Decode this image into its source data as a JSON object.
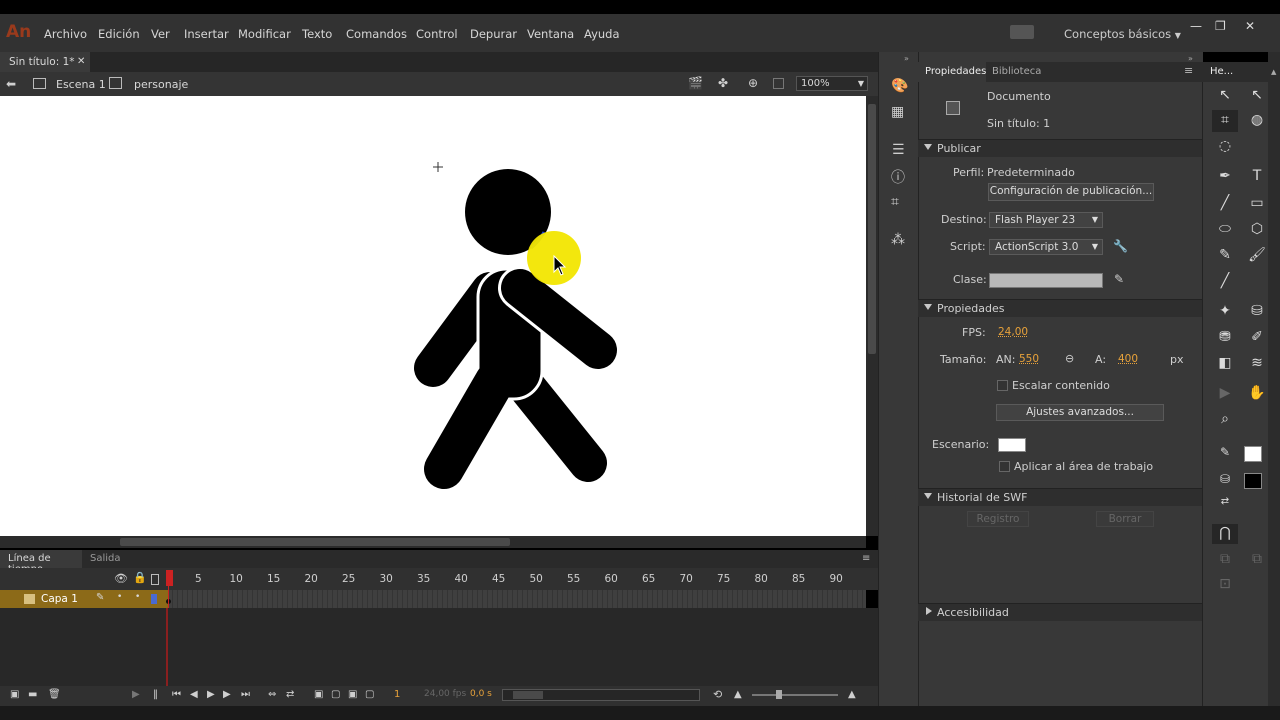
{
  "app": {
    "logo": "An",
    "menu": [
      "Archivo",
      "Edición",
      "Ver",
      "Insertar",
      "Modificar",
      "Texto",
      "Comandos",
      "Control",
      "Depurar",
      "Ventana",
      "Ayuda"
    ],
    "workspace": "Conceptos básicos",
    "window_buttons": [
      "—",
      "❐",
      "✕"
    ]
  },
  "document": {
    "tab_title": "Sin título: 1*",
    "breadcrumb_scene": "Escena 1",
    "breadcrumb_symbol": "personaje",
    "zoom": "100%"
  },
  "timeline": {
    "tabs": [
      "Línea de tiempo",
      "Salida"
    ],
    "layer_name": "Capa 1",
    "frame_ticks": [
      "1",
      "5",
      "10",
      "15",
      "20",
      "25",
      "30",
      "35",
      "40",
      "45",
      "50",
      "55",
      "60",
      "65",
      "70",
      "75",
      "80",
      "85",
      "90"
    ],
    "current_frame": "1",
    "fps_readout": "24,00 fps",
    "time_readout": "0,0 s"
  },
  "properties": {
    "tabs": [
      "Propiedades",
      "Biblioteca"
    ],
    "doc_type": "Documento",
    "doc_name": "Sin título: 1",
    "publish_section": "Publicar",
    "profile_label": "Perfil:",
    "profile_value": "Predeterminado",
    "publish_settings_button": "Configuración de publicación...",
    "target_label": "Destino:",
    "target_value": "Flash Player 23",
    "script_label": "Script:",
    "script_value": "ActionScript 3.0",
    "class_label": "Clase:",
    "props_section": "Propiedades",
    "fps_label": "FPS:",
    "fps_value": "24,00",
    "size_label": "Tamaño:",
    "width_label": "AN:",
    "width_value": "550",
    "height_label": "A:",
    "height_value": "400",
    "unit": "px",
    "scale_content": "Escalar contenido",
    "advanced_button": "Ajustes avanzados...",
    "stage_label": "Escenario:",
    "stage_color": "#ffffff",
    "apply_workarea": "Aplicar al área de trabajo",
    "swf_history_section": "Historial de SWF",
    "log_button": "Registro",
    "clear_button": "Borrar",
    "accessibility_section": "Accesibilidad"
  },
  "tools_panel": {
    "title": "He...",
    "stroke_color": "#ffffff",
    "fill_color": "#000000"
  },
  "colors": {
    "panel_bg": "#383838",
    "accent_orange": "#e8a23a",
    "layer_highlight": "#8c6a18",
    "playhead": "#cc2222",
    "yellow_dot": "#f2e600"
  }
}
